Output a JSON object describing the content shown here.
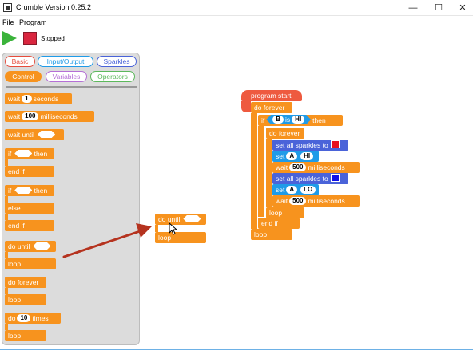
{
  "window": {
    "title": "Crumble Version 0.25.2",
    "minimize": "—",
    "maximize": "☐",
    "close": "✕"
  },
  "menu": {
    "file": "File",
    "program": "Program"
  },
  "toolbar": {
    "status": "Stopped",
    "play_icon": "play-icon",
    "stop_icon": "stop-icon",
    "stop_color": "#d9263f"
  },
  "categories": [
    {
      "label": "Basic",
      "color": "#e74c3c",
      "selected": false
    },
    {
      "label": "Input/Output",
      "color": "#1f9be8",
      "selected": false
    },
    {
      "label": "Sparkles",
      "color": "#4a63d9",
      "selected": false
    },
    {
      "label": "Control",
      "color": "#f7931e",
      "selected": true
    },
    {
      "label": "Variables",
      "color": "#b56fd6",
      "selected": false
    },
    {
      "label": "Operators",
      "color": "#5cb85c",
      "selected": false
    }
  ],
  "palette": {
    "wait_label": "wait",
    "wait_value": "1",
    "wait_unit": "seconds",
    "wait_ms_label": "wait",
    "wait_ms_value": "100",
    "wait_ms_unit": "milliseconds",
    "wait_until": "wait until",
    "if1": "if",
    "then1": "then",
    "end_if1": "end if",
    "if2": "if",
    "then2": "then",
    "else": "else",
    "end_if2": "end if",
    "do_until": "do until",
    "loop1": "loop",
    "do_forever": "do forever",
    "loop2": "loop",
    "do": "do",
    "times_value": "10",
    "times": "times",
    "loop3": "loop"
  },
  "dragged_block": {
    "do_until": "do until",
    "loop": "loop"
  },
  "program": {
    "start": "program start",
    "do_forever_outer": "do forever",
    "if": "if",
    "cond_left": "B",
    "cond_op": "is",
    "cond_right": "HI",
    "then": "then",
    "do_forever_inner": "do forever",
    "sparkles_1": "set all sparkles to",
    "sparkles_1_color": "#e8101e",
    "set_1": "set",
    "set_1_var": "A",
    "set_1_val": "HI",
    "wait_1": "wait",
    "wait_1_val": "500",
    "wait_1_unit": "milliseconds",
    "sparkles_2": "set all sparkles to",
    "sparkles_2_color": "#1010e8",
    "set_2": "set",
    "set_2_var": "A",
    "set_2_val": "LO",
    "wait_2": "wait",
    "wait_2_val": "500",
    "wait_2_unit": "milliseconds",
    "loop_inner": "loop",
    "end_if": "end if",
    "loop_outer": "loop"
  },
  "annotation": {
    "arrow_color": "#b5331f"
  }
}
